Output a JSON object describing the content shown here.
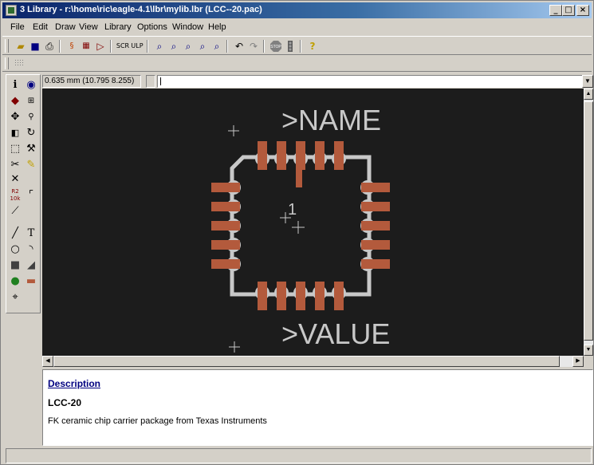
{
  "window": {
    "title": "3 Library - r:\\home\\ric\\eagle-4.1\\lbr\\mylib.lbr (LCC--20.pac)",
    "controls": [
      "minimize-icon",
      "maximize-icon",
      "close-icon"
    ]
  },
  "menu": [
    {
      "label": "File"
    },
    {
      "label": "Edit"
    },
    {
      "label": "Draw"
    },
    {
      "label": "View"
    },
    {
      "label": "Library"
    },
    {
      "label": "Options"
    },
    {
      "label": "Window"
    },
    {
      "label": "Help"
    }
  ],
  "toolbar": {
    "icons": [
      "open-icon",
      "save-icon",
      "print-icon",
      "cam-icon",
      "schematic-icon",
      "board-icon",
      "script-icon",
      "ulp-icon",
      "zoom-fit-icon",
      "zoom-in-icon",
      "zoom-out-icon",
      "zoom-redraw-icon",
      "zoom-select-icon",
      "undo-icon",
      "redo-icon",
      "stop-icon",
      "go-icon",
      "help-icon"
    ]
  },
  "command_bar": {
    "coordinate": "0.635 mm (10.795 8.255)",
    "command_value": ""
  },
  "left_palette": {
    "icons": [
      "info-icon",
      "show-icon",
      "display-icon",
      "mark-icon",
      "move-icon",
      "copy-icon",
      "mirror-icon",
      "rotate-icon",
      "group-icon",
      "change-icon",
      "cut-icon",
      "paste-icon",
      "delete-icon",
      "name-icon",
      "value-icon",
      "smash-icon",
      "miter-icon",
      "split-icon",
      "wire-icon",
      "text-icon",
      "circle-icon",
      "arc-icon",
      "rect-icon",
      "polygon-icon",
      "pad-icon",
      "smd-icon",
      "hole-icon"
    ]
  },
  "canvas": {
    "name_label": ">NAME",
    "value_label": ">VALUE",
    "pin_one": "1",
    "colors": {
      "background": "#1c1c1c",
      "pad": "#b35a3c",
      "outline": "#c8c8c8",
      "text": "#c8c8c8"
    }
  },
  "description": {
    "heading": "Description",
    "name": "LCC-20",
    "text": "FK ceramic chip carrier package from Texas Instruments"
  }
}
